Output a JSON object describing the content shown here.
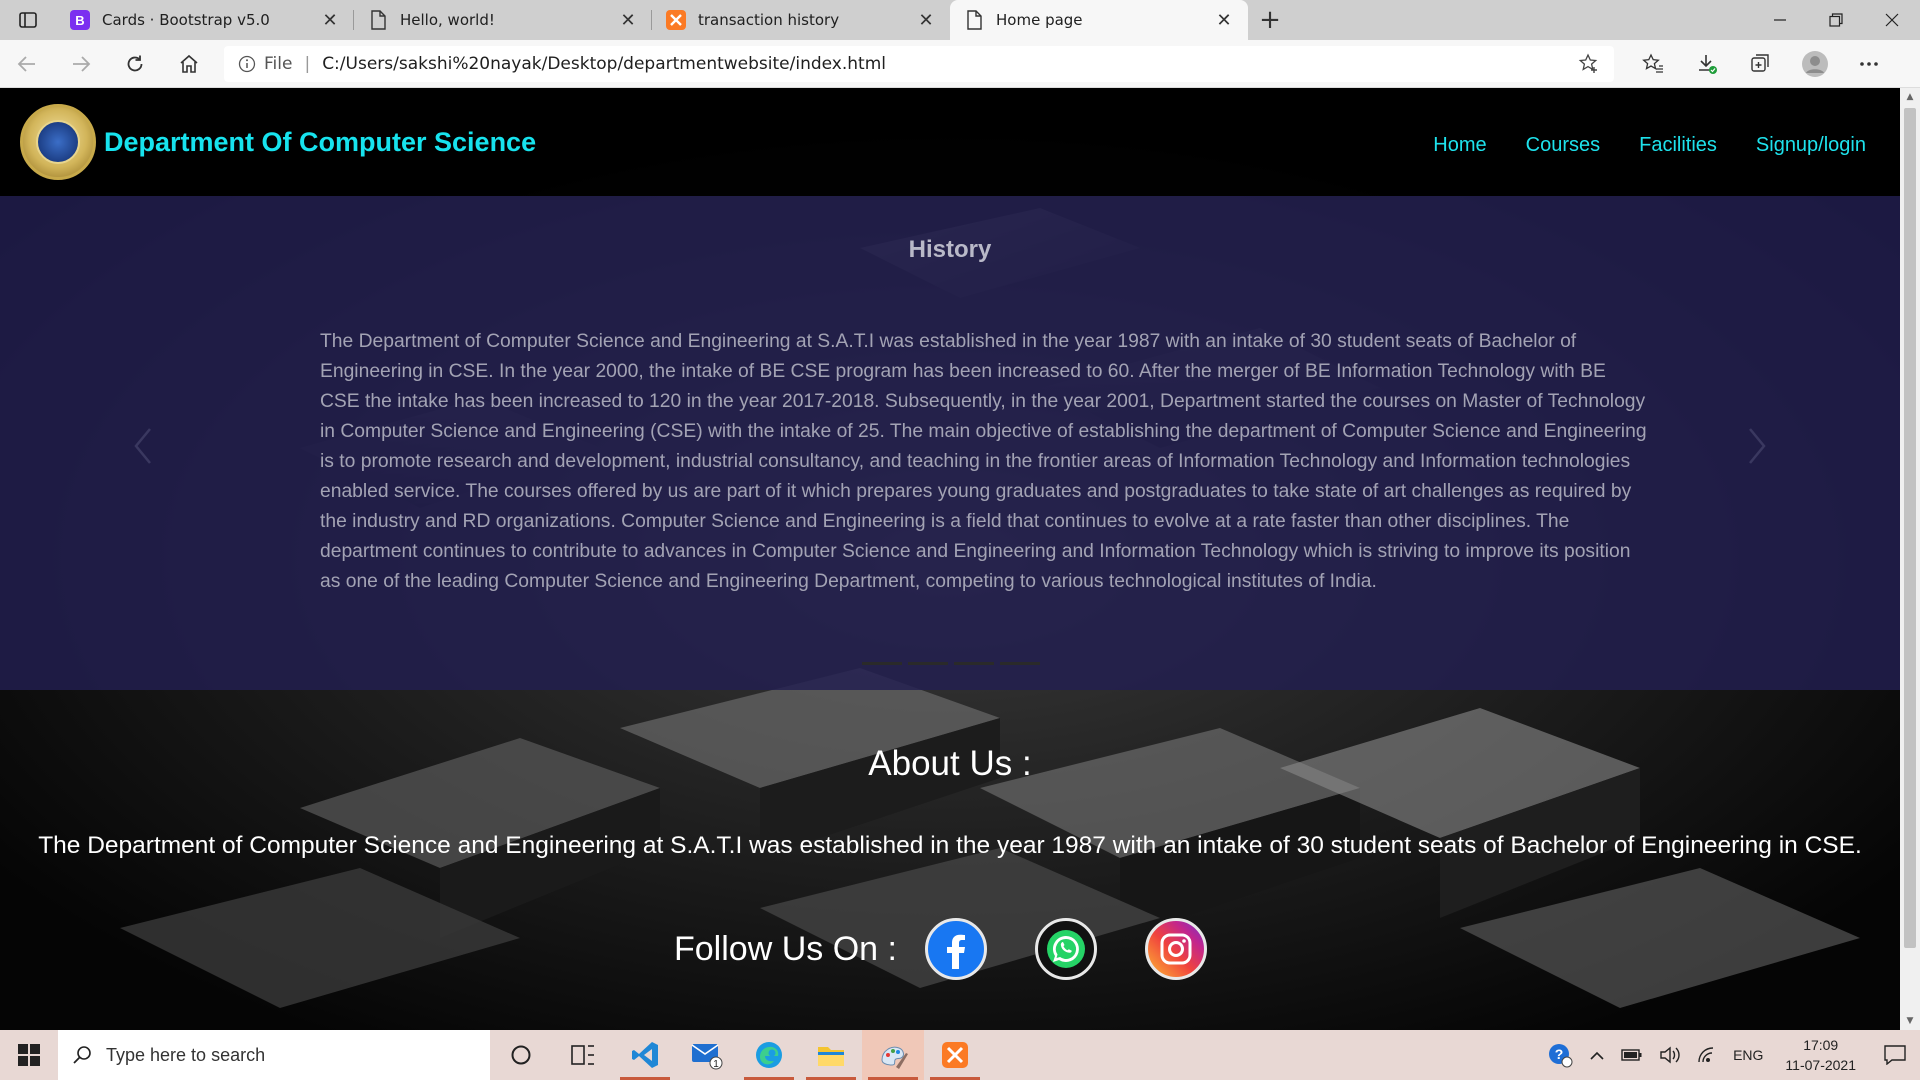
{
  "browser": {
    "tabs": [
      {
        "title": "Cards · Bootstrap v5.0",
        "icon": "bootstrap-icon",
        "active": false
      },
      {
        "title": "Hello, world!",
        "icon": "page-icon",
        "active": false
      },
      {
        "title": "transaction history",
        "icon": "xampp-icon",
        "active": false
      },
      {
        "title": "Home page",
        "icon": "page-icon",
        "active": true
      }
    ],
    "close_glyph": "✕",
    "newtab_glyph": "+",
    "address": {
      "scheme_label": "File",
      "url": "C:/Users/sakshi%20nayak/Desktop/departmentwebsite/index.html"
    }
  },
  "site": {
    "brand": "Department Of Computer Science",
    "nav": [
      "Home",
      "Courses",
      "Facilities",
      "Signup/login"
    ],
    "carousel": {
      "title": "History",
      "text": "The Department of Computer Science and Engineering at S.A.T.I was established in the year 1987 with an intake of 30 student seats of Bachelor of Engineering in CSE. In the year 2000, the intake of BE CSE program has been increased to 60. After the merger of BE Information Technology with BE CSE the intake has been increased to 120 in the year 2017-2018. Subsequently, in the year 2001, Department started the courses on Master of Technology in Computer Science and Engineering (CSE) with the intake of 25. The main objective of establishing the department of Computer Science and Engineering is to promote research and development, industrial consultancy, and teaching in the frontier areas of Information Technology and Information technologies enabled service. The courses offered by us are part of it which prepares young graduates and postgraduates to take state of art challenges as required by the industry and RD organizations. Computer Science and Engineering is a field that continues to evolve at a rate faster than other disciplines. The department continues to contribute to advances in Computer Science and Engineering and Information Technology which is striving to improve its position as one of the leading Computer Science and Engineering Department, competing to various technological institutes of India.",
      "slide_count": 4
    },
    "about": {
      "title": "About Us :",
      "text": "The Department of Computer Science and Engineering at S.A.T.I was established in the year 1987 with an intake of 30 student seats of Bachelor of Engineering in CSE."
    },
    "follow": {
      "label": "Follow Us On :",
      "networks": [
        "facebook-icon",
        "whatsapp-icon",
        "instagram-icon"
      ]
    }
  },
  "taskbar": {
    "search_placeholder": "Type here to search",
    "mail_badge": "1",
    "lang": "ENG",
    "time": "17:09",
    "date": "11-07-2021"
  },
  "colors": {
    "brand_cyan": "#17e3ee",
    "carousel_overlay": "#221e50",
    "taskbar": "#e8d8d4"
  }
}
